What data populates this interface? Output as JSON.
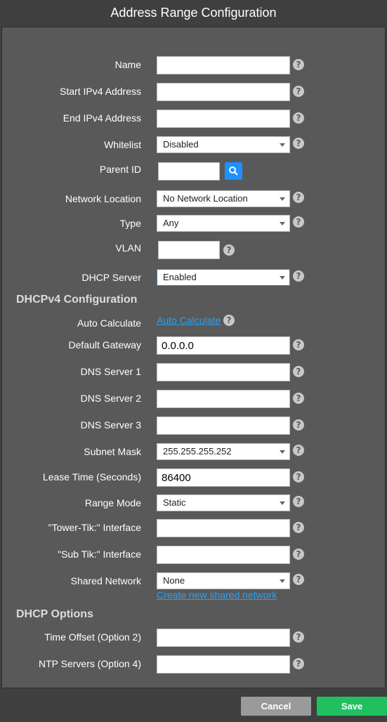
{
  "title": "Address Range Configuration",
  "fields": {
    "name": {
      "label": "Name",
      "value": ""
    },
    "start_ipv4": {
      "label": "Start IPv4 Address",
      "value": ""
    },
    "end_ipv4": {
      "label": "End IPv4 Address",
      "value": ""
    },
    "whitelist": {
      "label": "Whitelist",
      "value": "Disabled"
    },
    "parent_id": {
      "label": "Parent ID",
      "value": ""
    },
    "network_location": {
      "label": "Network Location",
      "value": "No Network Location"
    },
    "type": {
      "label": "Type",
      "value": "Any"
    },
    "vlan": {
      "label": "VLAN",
      "value": ""
    },
    "dhcp_server": {
      "label": "DHCP Server",
      "value": "Enabled"
    }
  },
  "dhcpv4": {
    "heading": "DHCPv4 Configuration",
    "auto_calculate": {
      "label": "Auto Calculate",
      "link": "Auto Calculate"
    },
    "default_gateway": {
      "label": "Default Gateway",
      "value": "0.0.0.0"
    },
    "dns1": {
      "label": "DNS Server 1",
      "value": ""
    },
    "dns2": {
      "label": "DNS Server 2",
      "value": ""
    },
    "dns3": {
      "label": "DNS Server 3",
      "value": ""
    },
    "subnet_mask": {
      "label": "Subnet Mask",
      "value": "255.255.255.252"
    },
    "lease_time": {
      "label": "Lease Time (Seconds)",
      "value": "86400"
    },
    "range_mode": {
      "label": "Range Mode",
      "value": "Static"
    },
    "tower_tik": {
      "label": "\"Tower-Tik:\" Interface",
      "value": ""
    },
    "sub_tik": {
      "label": "\"Sub Tik:\" Interface",
      "value": ""
    },
    "shared_network": {
      "label": "Shared Network",
      "value": "None",
      "link": "Create new shared network"
    }
  },
  "dhcp_options": {
    "heading": "DHCP Options",
    "time_offset": {
      "label": "Time Offset (Option 2)",
      "value": ""
    },
    "ntp_servers": {
      "label": "NTP Servers (Option 4)",
      "value": ""
    }
  },
  "help_glyph": "?",
  "buttons": {
    "cancel": "Cancel",
    "save": "Save"
  }
}
